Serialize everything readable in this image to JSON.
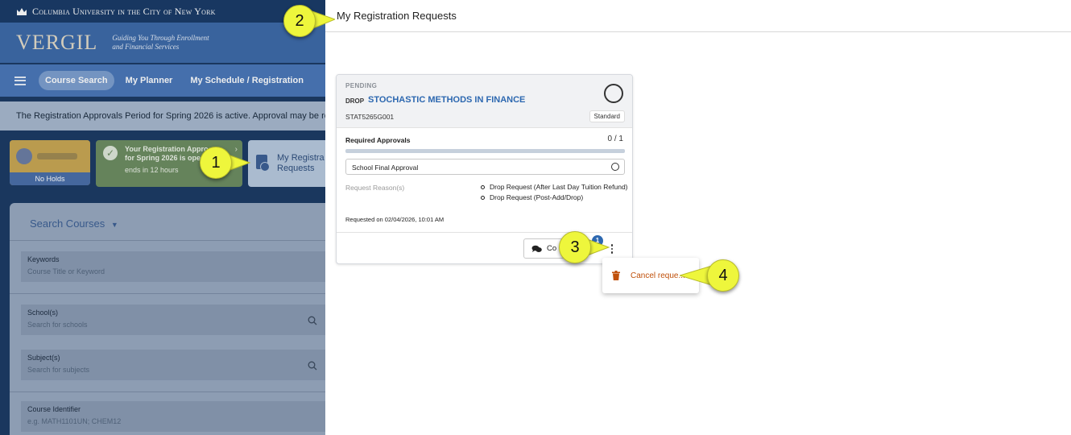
{
  "university_bar": {
    "text": "Columbia University in the City of New York"
  },
  "header": {
    "logo": "VERGIL",
    "tagline_line1": "Guiding You Through Enrollment",
    "tagline_line2": "and Financial Services"
  },
  "nav": {
    "tabs": [
      {
        "label": "Course Search",
        "active": true
      },
      {
        "label": "My Planner"
      },
      {
        "label": "My Schedule / Registration"
      }
    ]
  },
  "banner": {
    "text": "The Registration Approvals Period for Spring 2026 is active. Approval may be requ"
  },
  "summary_cards": {
    "holds_label": "No Holds",
    "approvals_line1": "Your Registration Appro",
    "approvals_line2": "for Spring 2026 is ope",
    "approvals_line3": "ends in 12 hours",
    "my_requests_line1": "My Registra",
    "my_requests_line2": "Requests"
  },
  "search": {
    "title": "Search Courses",
    "fields": [
      {
        "label": "Keywords",
        "placeholder": "Course Title or Keyword"
      },
      {
        "label": "School(s)",
        "placeholder": "Search for schools"
      },
      {
        "label": "Subject(s)",
        "placeholder": "Search for subjects"
      },
      {
        "label": "Course Identifier",
        "placeholder": "e.g. MATH1101UN; CHEM12"
      }
    ]
  },
  "panel": {
    "title": "My Registration Requests",
    "request": {
      "status": "PENDING",
      "type": "DROP",
      "course_name": "STOCHASTIC METHODS IN FINANCE",
      "course_id": "STAT5265G001",
      "badge": "Standard",
      "required_approvals_label": "Required Approvals",
      "approvals_count": "0 / 1",
      "approvals_progress": 0,
      "approval_step": "School Final Approval",
      "reason_label": "Request Reason(s)",
      "reasons": [
        "Drop Request (After Last Day Tuition Refund)",
        "Drop Request (Post-Add/Drop)"
      ],
      "requested_on": "Requested on 02/04/2026, 10:01 AM",
      "comments_label": "Co",
      "comments_count": "1"
    },
    "menu": {
      "cancel_label": "Cancel reque..."
    }
  },
  "callouts": {
    "c1": "1",
    "c2": "2",
    "c3": "3",
    "c4": "4"
  },
  "colors": {
    "accent": "#2d68b0",
    "callout": "#eef63c",
    "danger": "#c0500a",
    "nav_bg": "#4a77b8"
  }
}
